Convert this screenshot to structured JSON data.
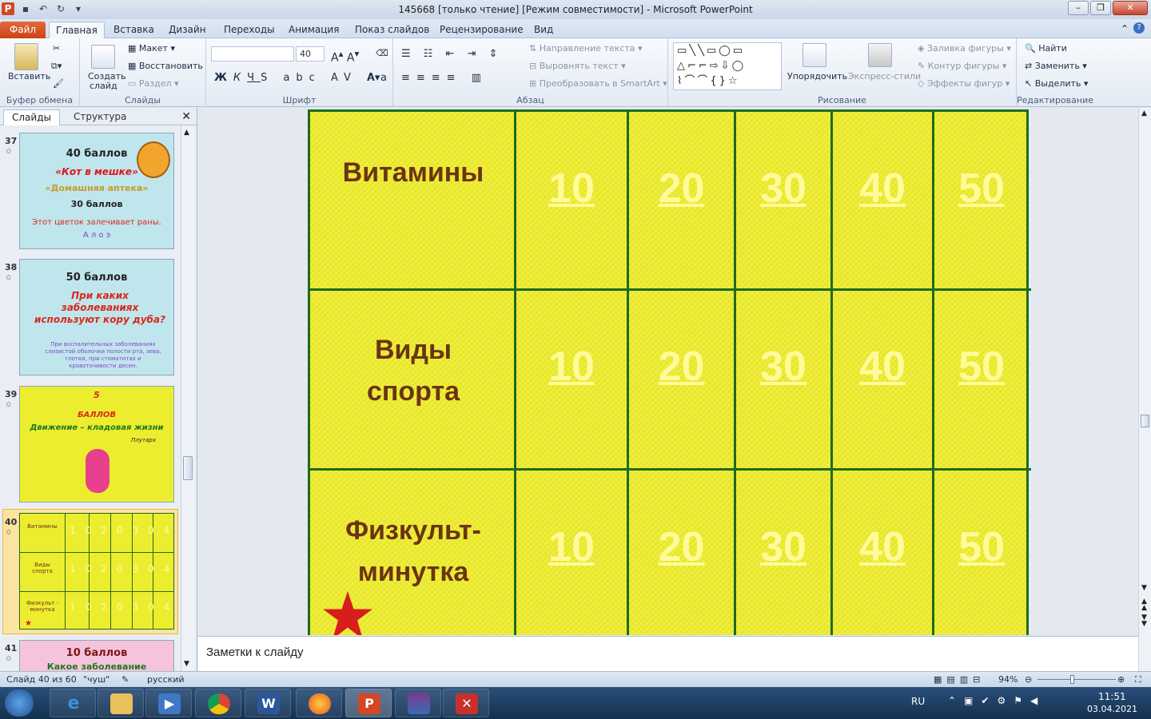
{
  "window": {
    "title": "145668 [только чтение] [Режим совместимости]  -  Microsoft PowerPoint"
  },
  "tabs": [
    "Файл",
    "Главная",
    "Вставка",
    "Дизайн",
    "Переходы",
    "Анимация",
    "Показ слайдов",
    "Рецензирование",
    "Вид"
  ],
  "ribbon": {
    "clipboard": {
      "paste": "Вставить",
      "label": "Буфер обмена"
    },
    "slides": {
      "create": "Создать",
      "create2": "слайд",
      "layout": "Макет",
      "reset": "Восстановить",
      "section": "Раздел",
      "label": "Слайды"
    },
    "font": {
      "size": "40",
      "label": "Шрифт"
    },
    "paragraph": {
      "direction": "Направление текста",
      "align": "Выровнять текст",
      "smartart": "Преобразовать в SmartArt",
      "label": "Абзац"
    },
    "drawing": {
      "arrange": "Упорядочить",
      "styles": "Экспресс-стили",
      "fill": "Заливка фигуры",
      "outline": "Контур фигуры",
      "effects": "Эффекты фигур",
      "label": "Рисование"
    },
    "editing": {
      "find": "Найти",
      "replace": "Заменить",
      "select": "Выделить",
      "label": "Редактирование"
    }
  },
  "panel": {
    "tab_slides": "Слайды",
    "tab_outline": "Структура"
  },
  "thumbs": {
    "s37": {
      "num": "37",
      "title": "40 баллов",
      "sub": "«Кот в мешке»",
      "cat": "«Домашняя аптека»",
      "pts": "30 баллов",
      "q": "Этот цветок залечивает раны.",
      "a": "А л о э"
    },
    "s38": {
      "num": "38",
      "title": "50 баллов",
      "q": "При каких заболеваниях используют кору дуба?",
      "a": "При воспалительных заболеваниях слизистой оболочки полости рта, зева, глотки, при стоматитах и кровоточивости десен."
    },
    "s39": {
      "num": "39",
      "n": "5",
      "b": "БАЛЛОВ",
      "t": "Движение – кладовая жизни",
      "s": "Плутарх"
    },
    "s40": {
      "num": "40",
      "r1": "Витамины",
      "r2": "Виды спорта",
      "r3": "Физкульт - минутка"
    },
    "s41": {
      "num": "41",
      "title": "10 баллов",
      "q": "Какое заболевание"
    }
  },
  "board": {
    "categories": [
      "Витамины",
      "Виды спорта",
      "Физкульт- минутка"
    ],
    "points": [
      "10",
      "20",
      "30",
      "40",
      "50"
    ]
  },
  "notes": "Заметки к слайду",
  "status": {
    "slide": "Слайд 40 из 60",
    "theme": "\"чуш\"",
    "lang": "русский",
    "zoom": "94%"
  },
  "taskbar": {
    "lang": "RU",
    "time": "11:51",
    "date": "03.04.2021"
  }
}
